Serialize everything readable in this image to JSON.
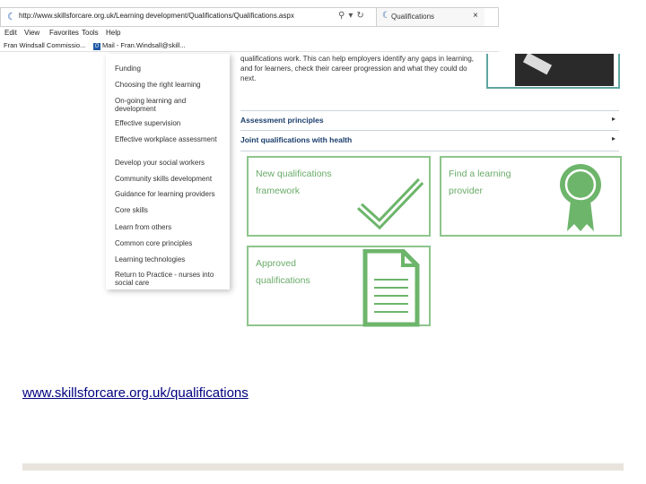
{
  "browser": {
    "url": "http://www.skillsforcare.org.uk/Learning development/Qualifications/Qualifications.aspx",
    "tab_label": "Qualifications",
    "tab_close": "×",
    "menu": [
      "Edit",
      "View",
      "Favorites",
      "Tools",
      "Help"
    ],
    "favorites": [
      "Fran Windsall Commissio...",
      "Mail - Fran.Windsall@skill..."
    ]
  },
  "sidebar": {
    "items": [
      "Funding",
      "Choosing the right learning",
      "On-going learning and development",
      "Effective supervision",
      "Effective workplace assessment",
      "Develop your social workers",
      "Community skills development",
      "Guidance for learning providers",
      "Core skills",
      "Learn from others",
      "Common core principles",
      "Learning technologies",
      "Return to Practice - nurses into social care"
    ]
  },
  "main": {
    "intro": "qualifications work. This can help employers identify any gaps in learning, and for learners, check their career progression and what they could do next.",
    "sections": [
      {
        "label": "Assessment principles",
        "arrow": "▸"
      },
      {
        "label": "Joint qualifications with health",
        "arrow": "▸"
      }
    ],
    "cards": [
      {
        "title_line1": "New qualifications",
        "title_line2": "framework",
        "icon": "checkmark-icon"
      },
      {
        "title_line1": "Find a learning",
        "title_line2": "provider",
        "icon": "award-ribbon-icon"
      },
      {
        "title_line1": "Approved",
        "title_line2": "qualifications",
        "icon": "document-icon"
      }
    ]
  },
  "slide": {
    "link": "www.skillsforcare.org.uk/qualifications"
  },
  "colors": {
    "card_green": "#8dc58c",
    "icon_green": "#6db56b",
    "heading_blue": "#1a3d6b",
    "link_blue": "#000080"
  }
}
